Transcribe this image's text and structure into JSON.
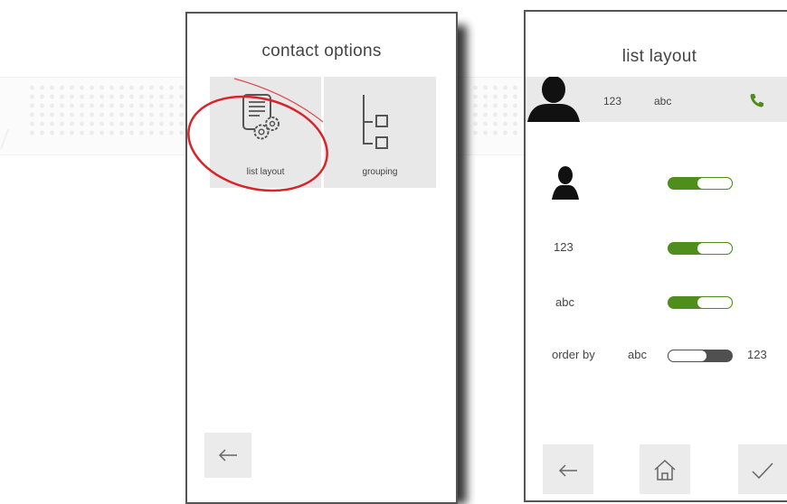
{
  "left_screen": {
    "title": "contact options",
    "tiles": [
      {
        "label": "list layout",
        "icon": "document-settings-icon"
      },
      {
        "label": "grouping",
        "icon": "grouping-tree-icon"
      }
    ],
    "back_icon": "arrow-left-icon"
  },
  "right_screen": {
    "title": "list layout",
    "preview": {
      "number": "123",
      "name": "abc",
      "call_icon": "phone-icon"
    },
    "settings": {
      "avatar_label_icon": "person-silhouette-icon",
      "number_label": "123",
      "name_label": "abc",
      "order_label": "order by",
      "order_left": "abc",
      "order_right": "123"
    },
    "toggle_states": {
      "avatar": "on",
      "number": "on",
      "name": "on",
      "order_by": "123"
    },
    "footer_icons": [
      "arrow-left-icon",
      "home-icon",
      "checkmark-icon"
    ]
  },
  "colors": {
    "accent_green": "#4f8d1c",
    "highlight_circle": "#d7262b",
    "tile_bg": "#e8e8e8"
  }
}
